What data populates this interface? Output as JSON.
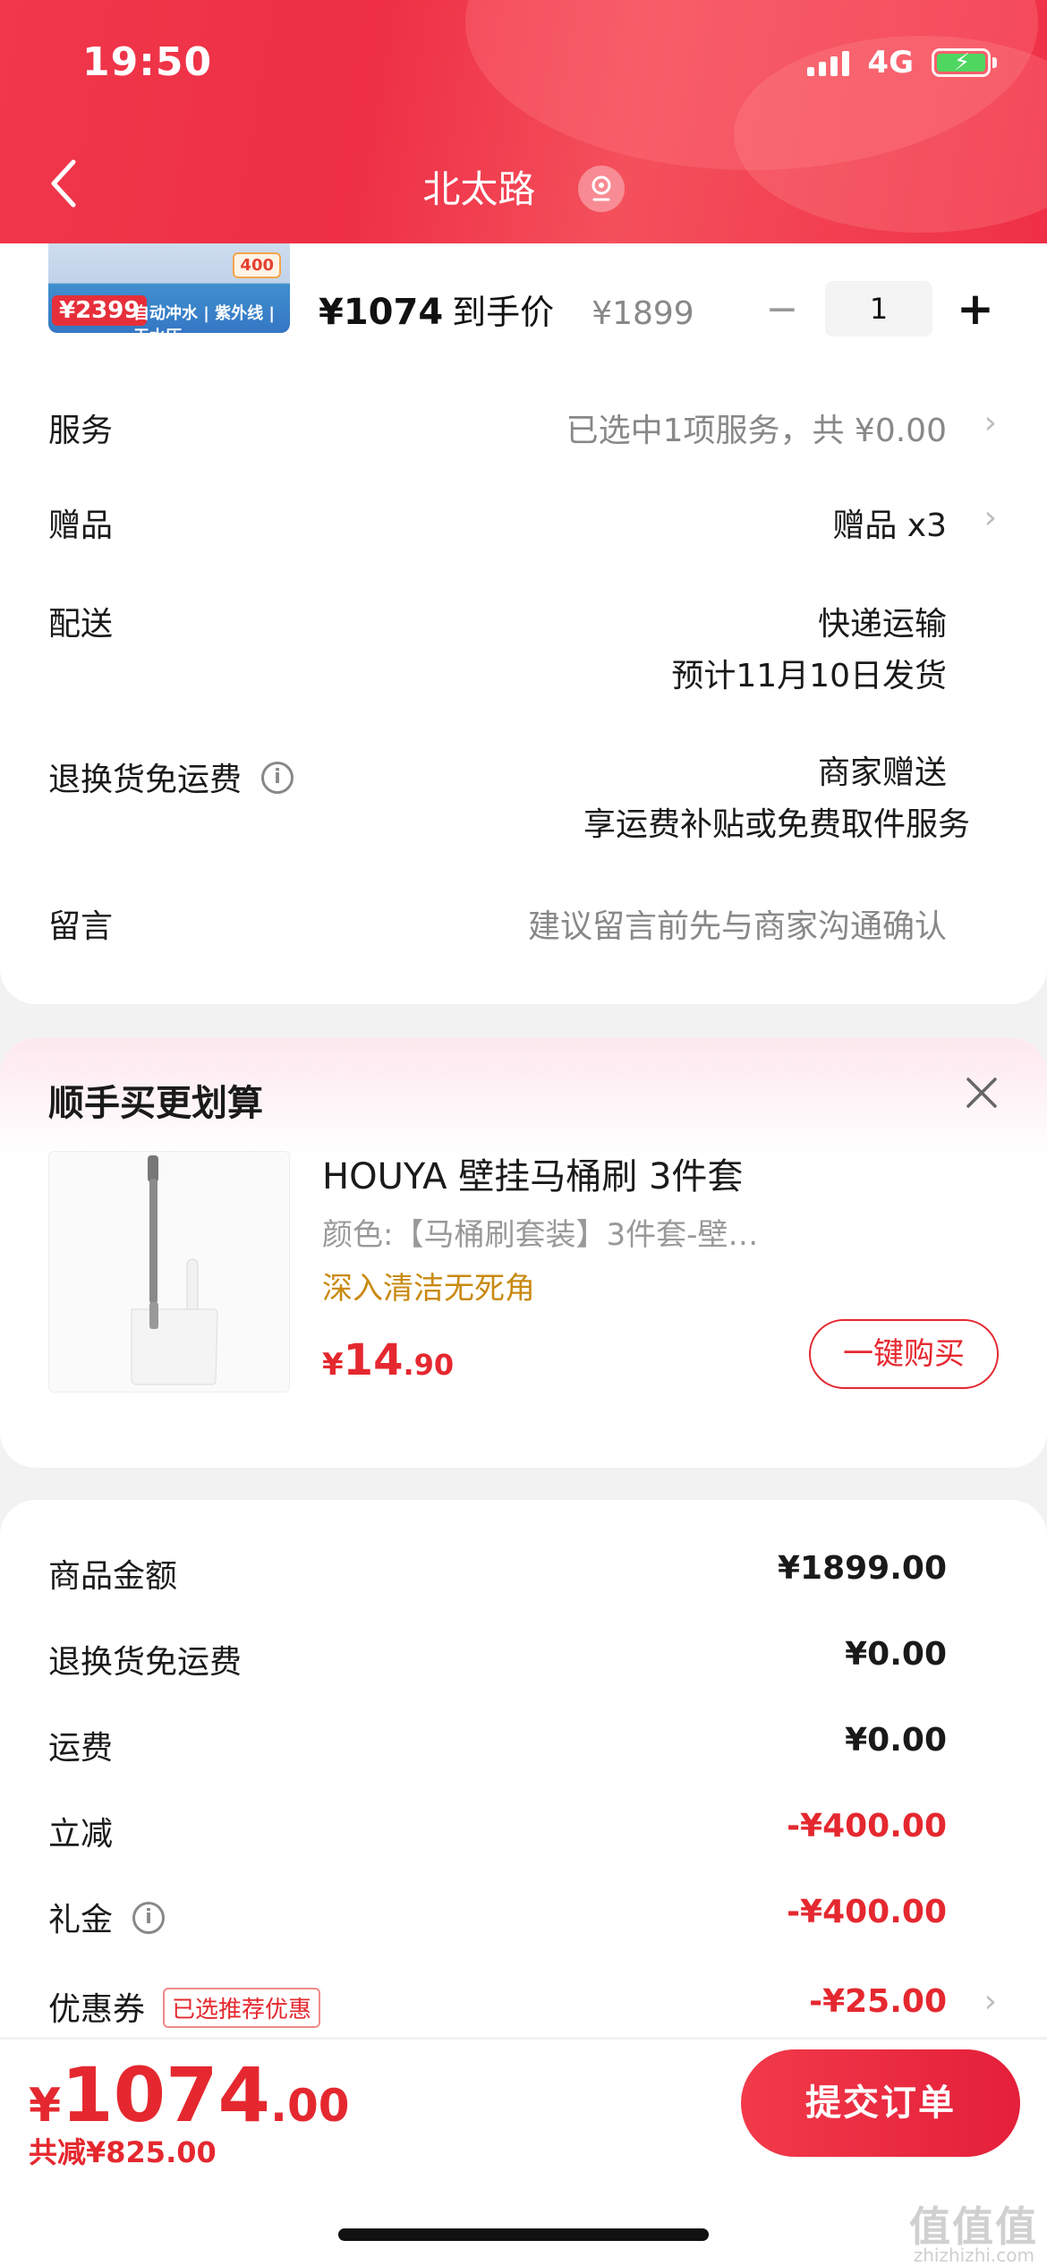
{
  "status_bar": {
    "time": "19:50",
    "network": "4G"
  },
  "nav": {
    "title": "北太路"
  },
  "product": {
    "thumb_price": "¥2399",
    "thumb_features": "自动冲水 | 紫外线 | 无水压",
    "thumb_tag": "400",
    "price_now": "¥1074",
    "price_label": "到手价",
    "price_original": "¥1899",
    "quantity": "1"
  },
  "details": {
    "service_label": "服务",
    "service_value": "已选中1项服务，共 ¥0.00",
    "gift_label": "赠品",
    "gift_value": "赠品 x3",
    "delivery_label": "配送",
    "delivery_method": "快递运输",
    "delivery_date": "预计11月10日发货",
    "return_label": "退换货免运费",
    "return_value1": "商家赠送",
    "return_value2": "享运费补贴或免费取件服务",
    "message_label": "留言",
    "message_placeholder": "建议留言前先与商家沟通确认"
  },
  "addon": {
    "title": "顺手买更划算",
    "name": "HOUYA 壁挂马桶刷 3件套",
    "spec": "颜色:【马桶刷套装】3件套-壁…",
    "tag": "深入清洁无死角",
    "price_symbol": "¥",
    "price_int": "14",
    "price_dec": ".90",
    "buy_label": "一键购买"
  },
  "amounts": {
    "goods_label": "商品金额",
    "goods_value": "¥1899.00",
    "return_label": "退换货免运费",
    "return_value": "¥0.00",
    "shipping_label": "运费",
    "shipping_value": "¥0.00",
    "discount_label": "立减",
    "discount_value": "-¥400.00",
    "gift_money_label": "礼金",
    "gift_money_value": "-¥400.00",
    "coupon_label": "优惠券",
    "coupon_tag": "已选推荐优惠",
    "coupon_value": "-¥25.00"
  },
  "footer": {
    "total_symbol": "¥",
    "total_int": "1074",
    "total_dec": ".00",
    "saved": "共减¥825.00",
    "submit_label": "提交订单"
  },
  "watermark": {
    "text": "值值值",
    "sub": "zhizhizhi.com"
  },
  "colors": {
    "accent": "#e5282f",
    "header": "#ee2f45",
    "tag_gold": "#c98a12"
  }
}
